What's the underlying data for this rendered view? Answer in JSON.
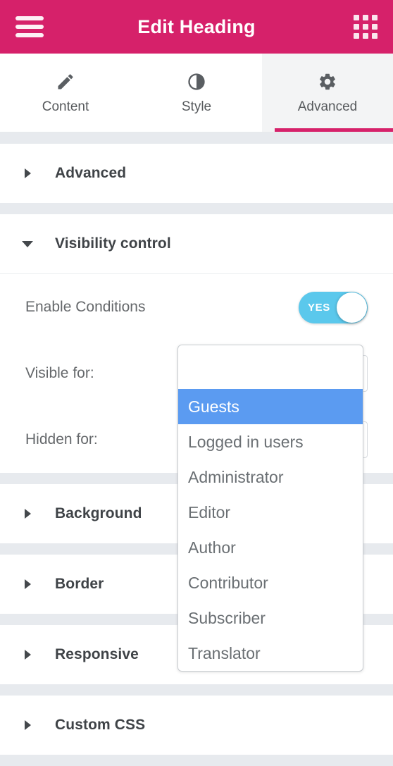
{
  "header": {
    "title": "Edit Heading",
    "menu_icon": "hamburger-menu-icon",
    "apps_icon": "apps-grid-icon",
    "background_color": "#d6216a"
  },
  "tabs": [
    {
      "label": "Content",
      "icon": "pencil-icon",
      "active": false
    },
    {
      "label": "Style",
      "icon": "contrast-icon",
      "active": false
    },
    {
      "label": "Advanced",
      "icon": "gear-icon",
      "active": true
    }
  ],
  "sections": [
    {
      "title": "Advanced",
      "expanded": false
    },
    {
      "title": "Visibility control",
      "expanded": true
    },
    {
      "title": "Background",
      "expanded": false
    },
    {
      "title": "Border",
      "expanded": false
    },
    {
      "title": "Responsive",
      "expanded": false
    },
    {
      "title": "Custom CSS",
      "expanded": false
    }
  ],
  "visibility_control": {
    "enable_conditions": {
      "label": "Enable Conditions",
      "toggle_value": "YES",
      "toggle_on": true,
      "toggle_color": "#5bc8ec"
    },
    "visible_for": {
      "label": "Visible for:",
      "value": ""
    },
    "hidden_for": {
      "label": "Hidden for:",
      "value": ""
    }
  },
  "dropdown": {
    "open": true,
    "blank_option": "",
    "selected": "Guests",
    "selected_color": "#5b9bf1",
    "options": [
      "Guests",
      "Logged in users",
      "Administrator",
      "Editor",
      "Author",
      "Contributor",
      "Subscriber",
      "Translator"
    ]
  }
}
